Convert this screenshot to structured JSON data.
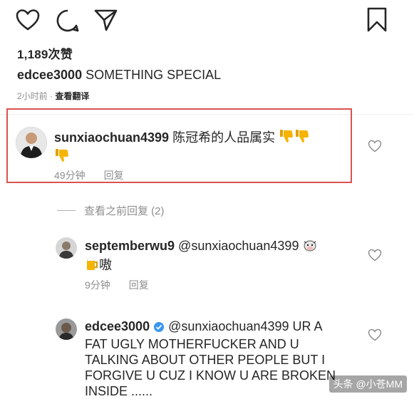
{
  "post": {
    "likes": "1,189次赞",
    "caption_user": "edcee3000",
    "caption_text": " SOMETHING SPECIAL",
    "time": "2小时前",
    "translate": "查看翻译"
  },
  "comments": [
    {
      "user": "sunxiaochuan4399",
      "text": " 陈冠希的人品属实",
      "time": "49分钟",
      "reply": "回复"
    }
  ],
  "view_replies": "查看之前回复 (2)",
  "replies": [
    {
      "user": "septemberwu9",
      "text_line1": " @sunxiaochuan4399",
      "text_line2": "嗷",
      "time": "9分钟",
      "reply": "回复"
    },
    {
      "user": "edcee3000",
      "text_line1": " @sunxiaochuan4399 UR A",
      "text_line2": "FAT UGLY MOTHERFUCKER AND U",
      "text_line3": "TALKING ABOUT OTHER PEOPLE BUT I",
      "text_line4": "FORGIVE U CUZ I KNOW U ARE BROKEN",
      "text_line5": "INSIDE ......"
    }
  ],
  "watermark": "头条 @小苍MM",
  "icons": [
    "heart-icon",
    "comment-icon",
    "share-icon",
    "bookmark-icon",
    "thumbs-down-icon",
    "verified-badge-icon",
    "cow-emoji-icon",
    "beer-emoji-icon"
  ],
  "colors": {
    "highlight": "#d9534f",
    "verified": "#3897f0",
    "muted": "#8e8e8e",
    "emoji": "#f5b400"
  }
}
